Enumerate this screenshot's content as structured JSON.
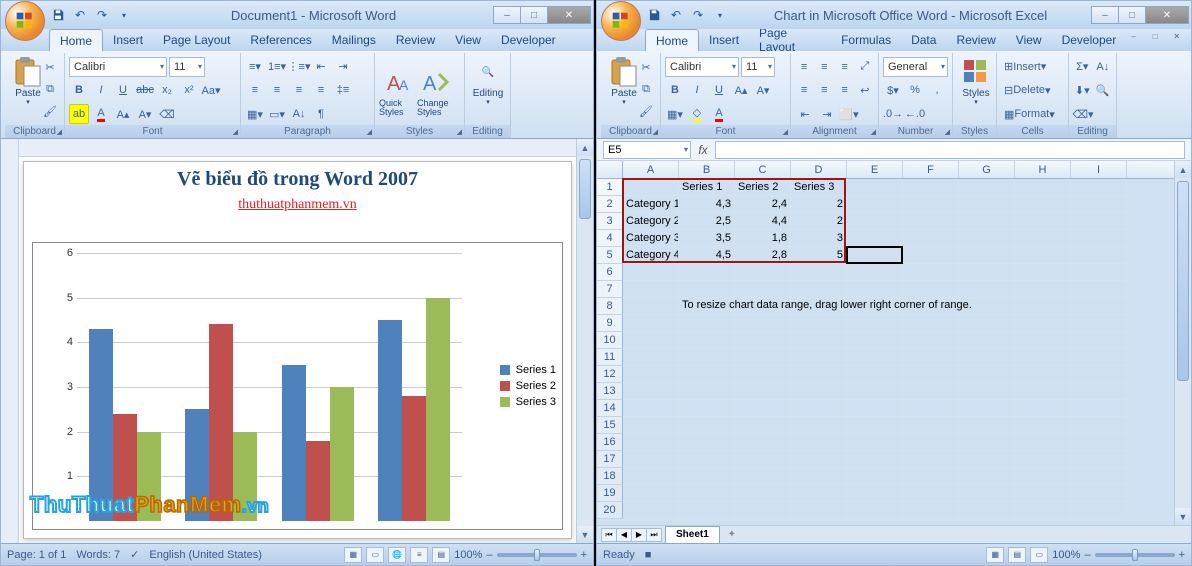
{
  "word": {
    "title": "Document1 - Microsoft Word",
    "tabs": [
      "Home",
      "Insert",
      "Page Layout",
      "References",
      "Mailings",
      "Review",
      "View",
      "Developer"
    ],
    "active_tab": 0,
    "groups": {
      "clipboard": "Clipboard",
      "font": "Font",
      "paragraph": "Paragraph",
      "styles": "Styles",
      "editing": "Editing"
    },
    "paste": "Paste",
    "quick_styles": "Quick Styles",
    "change_styles": "Change Styles",
    "editing": "Editing",
    "font_name": "Calibri",
    "font_size": "11",
    "doc_title": "Vẽ biểu đồ trong Word 2007",
    "doc_link": "thuthuatphanmem.vn",
    "status": {
      "page": "Page: 1 of 1",
      "words": "Words: 7",
      "lang": "English (United States)",
      "zoom": "100%"
    }
  },
  "excel": {
    "title": "Chart in Microsoft Office Word - Microsoft Excel",
    "tabs": [
      "Home",
      "Insert",
      "Page Layout",
      "Formulas",
      "Data",
      "Review",
      "View",
      "Developer"
    ],
    "active_tab": 0,
    "groups": {
      "clipboard": "Clipboard",
      "font": "Font",
      "alignment": "Alignment",
      "number": "Number",
      "styles": "Styles",
      "cells": "Cells",
      "editing": "Editing"
    },
    "paste": "Paste",
    "styles": "Styles",
    "font_name": "Calibri",
    "font_size": "11",
    "number_format": "General",
    "insert": "Insert",
    "delete": "Delete",
    "format": "Format",
    "namebox": "E5",
    "columns": [
      "A",
      "B",
      "C",
      "D",
      "E",
      "F",
      "G",
      "H",
      "I"
    ],
    "rows": 20,
    "headers": [
      "",
      "Series 1",
      "Series 2",
      "Series 3"
    ],
    "data": [
      [
        "Category 1",
        "4,3",
        "2,4",
        "2"
      ],
      [
        "Category 2",
        "2,5",
        "4,4",
        "2"
      ],
      [
        "Category 3",
        "3,5",
        "1,8",
        "3"
      ],
      [
        "Category 4",
        "4,5",
        "2,8",
        "5"
      ]
    ],
    "hint": "To resize chart data range, drag lower right corner of range.",
    "sheet": "Sheet1",
    "status": {
      "ready": "Ready",
      "zoom": "100%"
    }
  },
  "chart_data": {
    "type": "bar",
    "categories": [
      "Category 1",
      "Category 2",
      "Category 3",
      "Category 4"
    ],
    "series": [
      {
        "name": "Series 1",
        "values": [
          4.3,
          2.5,
          3.5,
          4.5
        ],
        "color": "#4f81bd"
      },
      {
        "name": "Series 2",
        "values": [
          2.4,
          4.4,
          1.8,
          2.8
        ],
        "color": "#c0504d"
      },
      {
        "name": "Series 3",
        "values": [
          2,
          2,
          3,
          5
        ],
        "color": "#9bbb59"
      }
    ],
    "ylim": [
      0,
      6
    ],
    "yticks": [
      1,
      2,
      3,
      4,
      5,
      6
    ]
  },
  "watermark": {
    "a": "ThuThuat",
    "b": "PhanMem",
    "c": ".vn"
  }
}
